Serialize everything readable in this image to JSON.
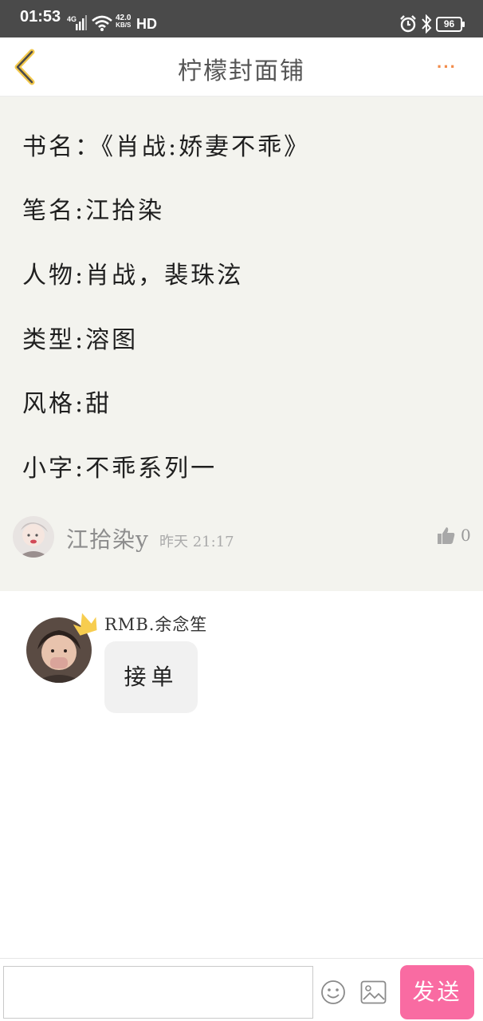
{
  "status_bar": {
    "time": "01:53",
    "network": "4G",
    "speed_value": "42.0",
    "speed_unit": "KB/S",
    "hd": "HD",
    "battery": "96"
  },
  "nav": {
    "title": "柠檬封面铺",
    "more": "···"
  },
  "post": {
    "lines": [
      "书名：《肖战:娇妻不乖》",
      "笔名:江拾染",
      "人物:肖战，裴珠泫",
      "类型:溶图",
      "风格:甜",
      "小字:不乖系列一"
    ],
    "author": "江拾染y",
    "time": "昨天 21:17",
    "likes": "0"
  },
  "reply": {
    "name": "RMB.余念笙",
    "message": "接单"
  },
  "input": {
    "value": "",
    "placeholder": "",
    "send_label": "发送"
  },
  "colors": {
    "accent_pink": "#f96ba2",
    "more_orange": "#f28c4b",
    "back_yellow": "#f2c84b",
    "post_bg": "#f3f3ee"
  }
}
